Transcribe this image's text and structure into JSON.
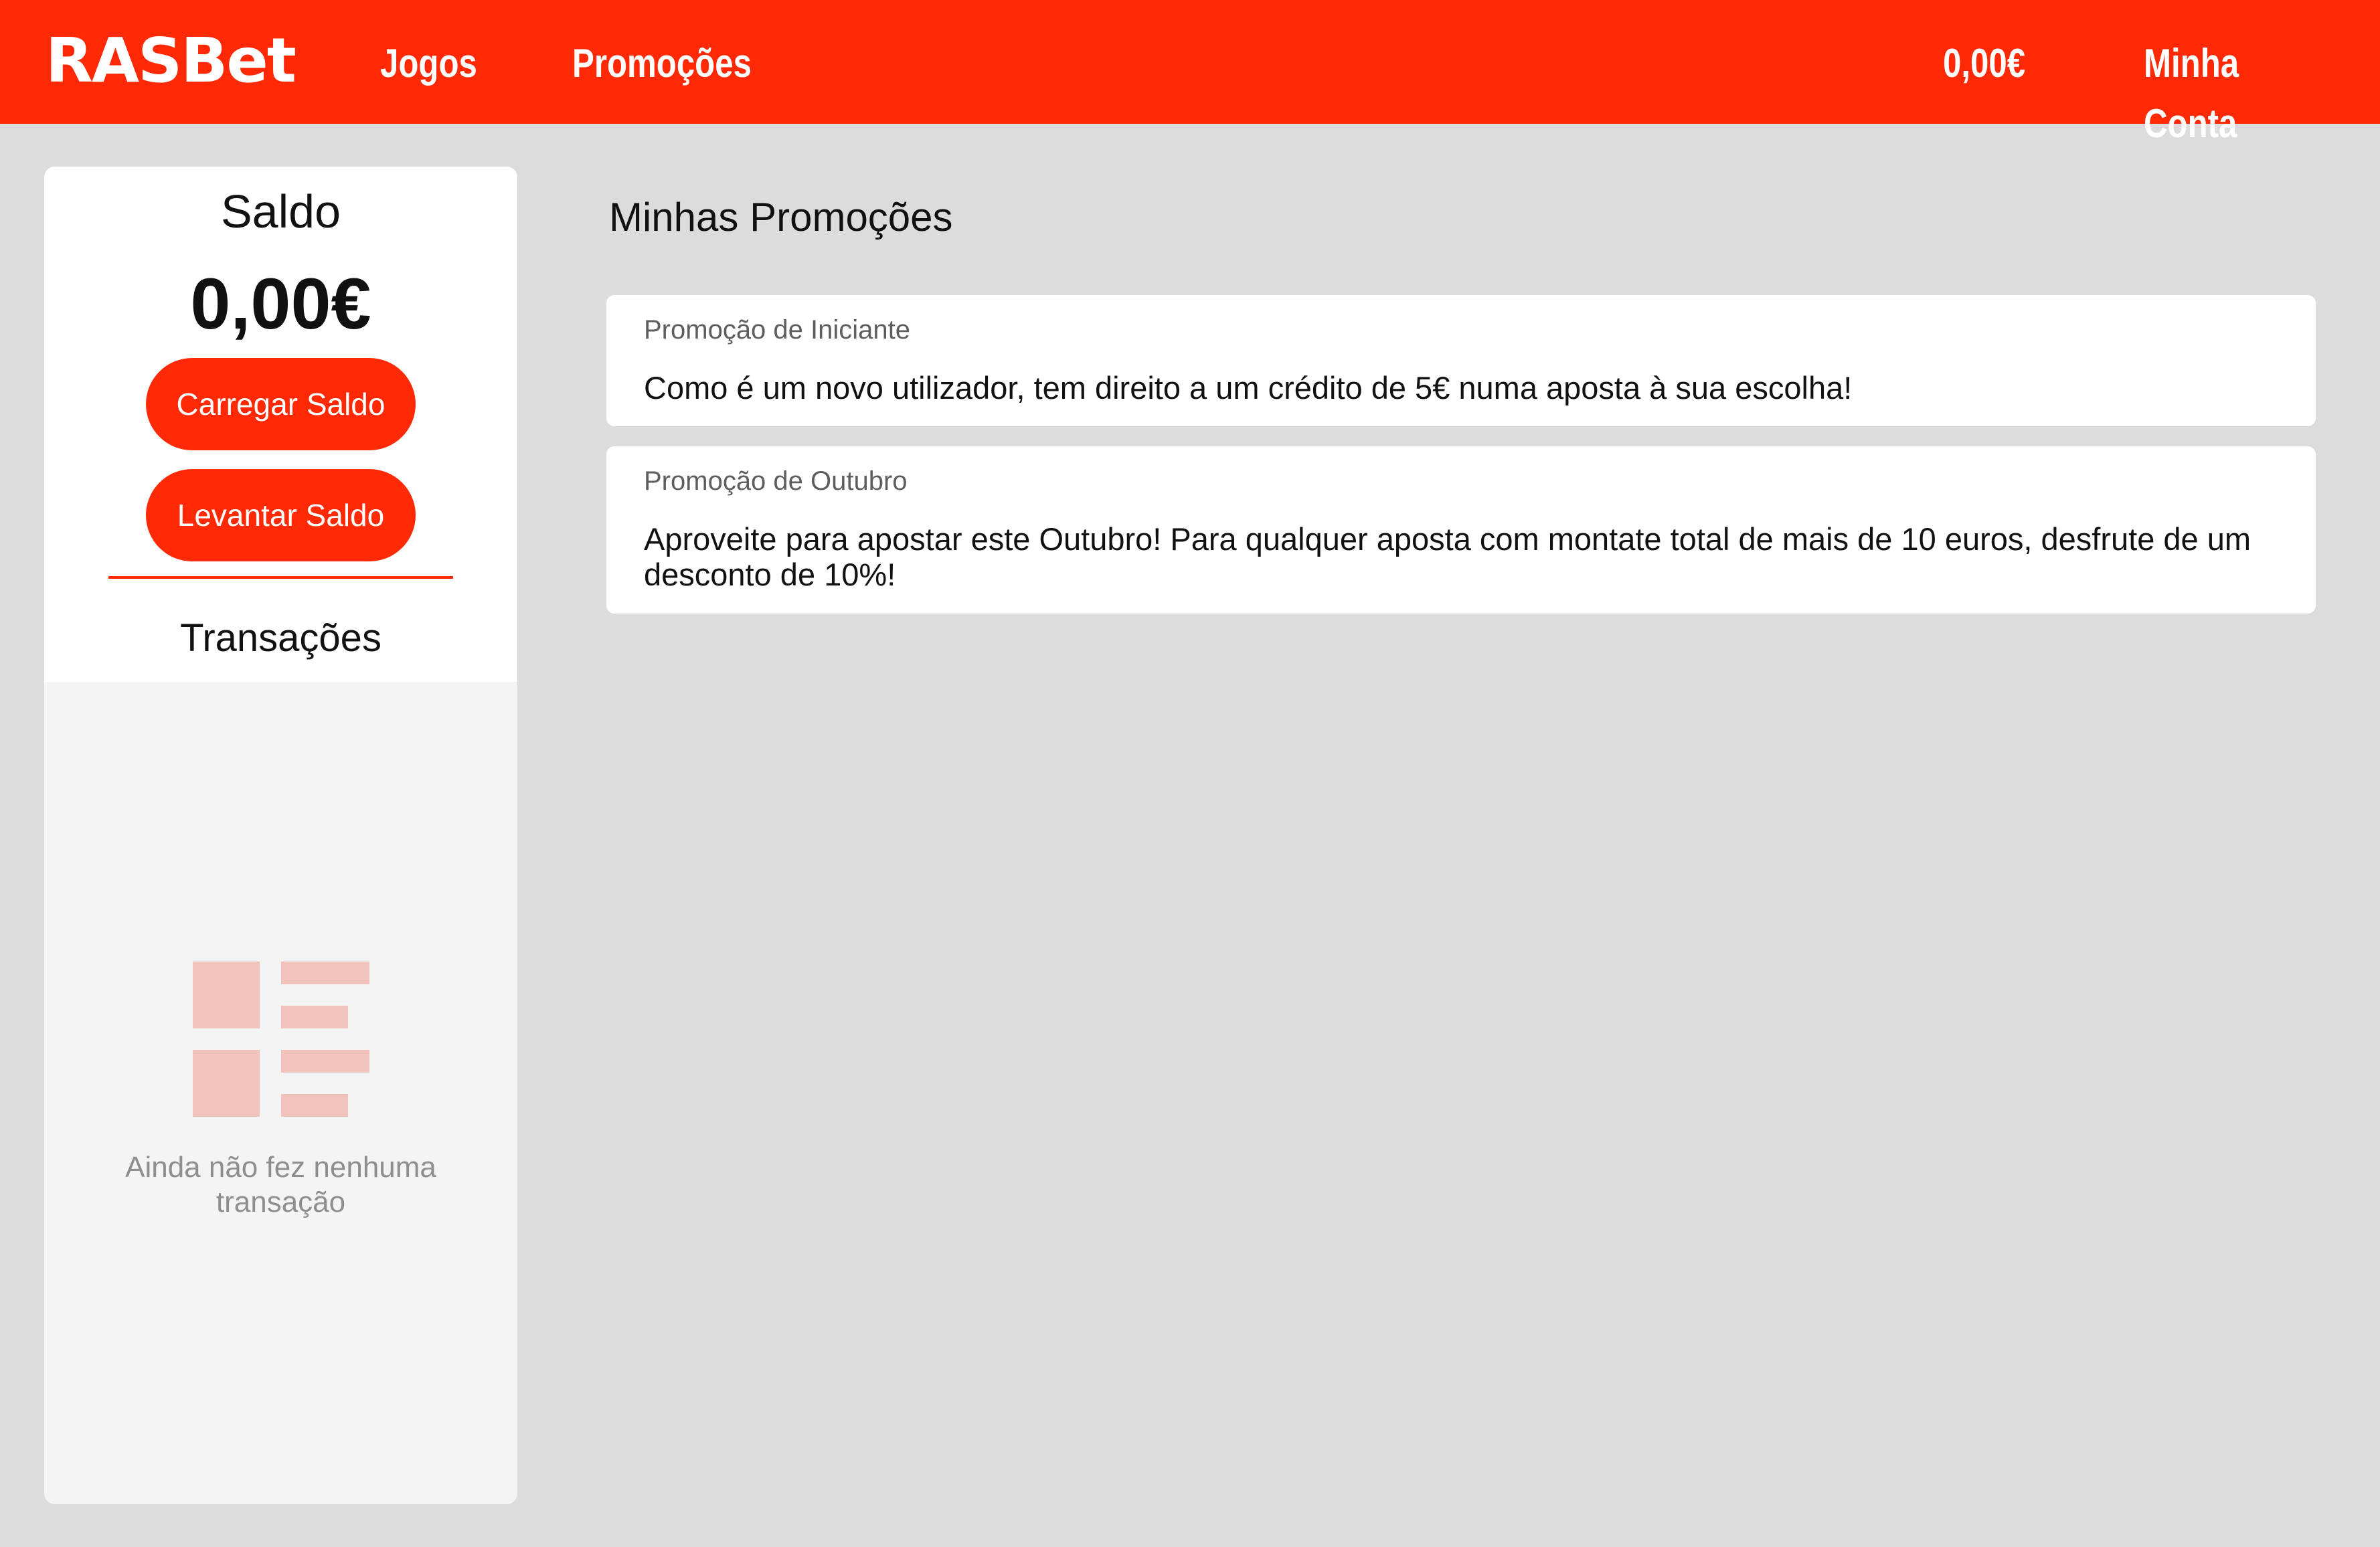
{
  "header": {
    "logo": "RASBet",
    "nav": {
      "jogos": "Jogos",
      "promocoes": "Promoções"
    },
    "balance": "0,00€",
    "account": "Minha Conta"
  },
  "sidebar": {
    "saldo_title": "Saldo",
    "saldo_value": "0,00€",
    "carregar_label": "Carregar Saldo",
    "levantar_label": "Levantar Saldo",
    "transacoes_title": "Transações",
    "empty_text": "Ainda não fez nenhuma transação",
    "empty_icon": "list-icon"
  },
  "main": {
    "title": "Minhas Promoções",
    "promotions": [
      {
        "label": "Promoção de Iniciante",
        "text": "Como é um novo utilizador, tem direito a um crédito de 5€ numa aposta à sua escolha!"
      },
      {
        "label": "Promoção de Outubro",
        "text": "Aproveite para apostar este Outubro! Para qualquer aposta com montate total de mais de 10 euros, desfrute de um desconto de 10%!"
      }
    ]
  },
  "colors": {
    "brand": "#ff2905",
    "background": "#dcdcdc",
    "icon": "#f2c3bc"
  }
}
